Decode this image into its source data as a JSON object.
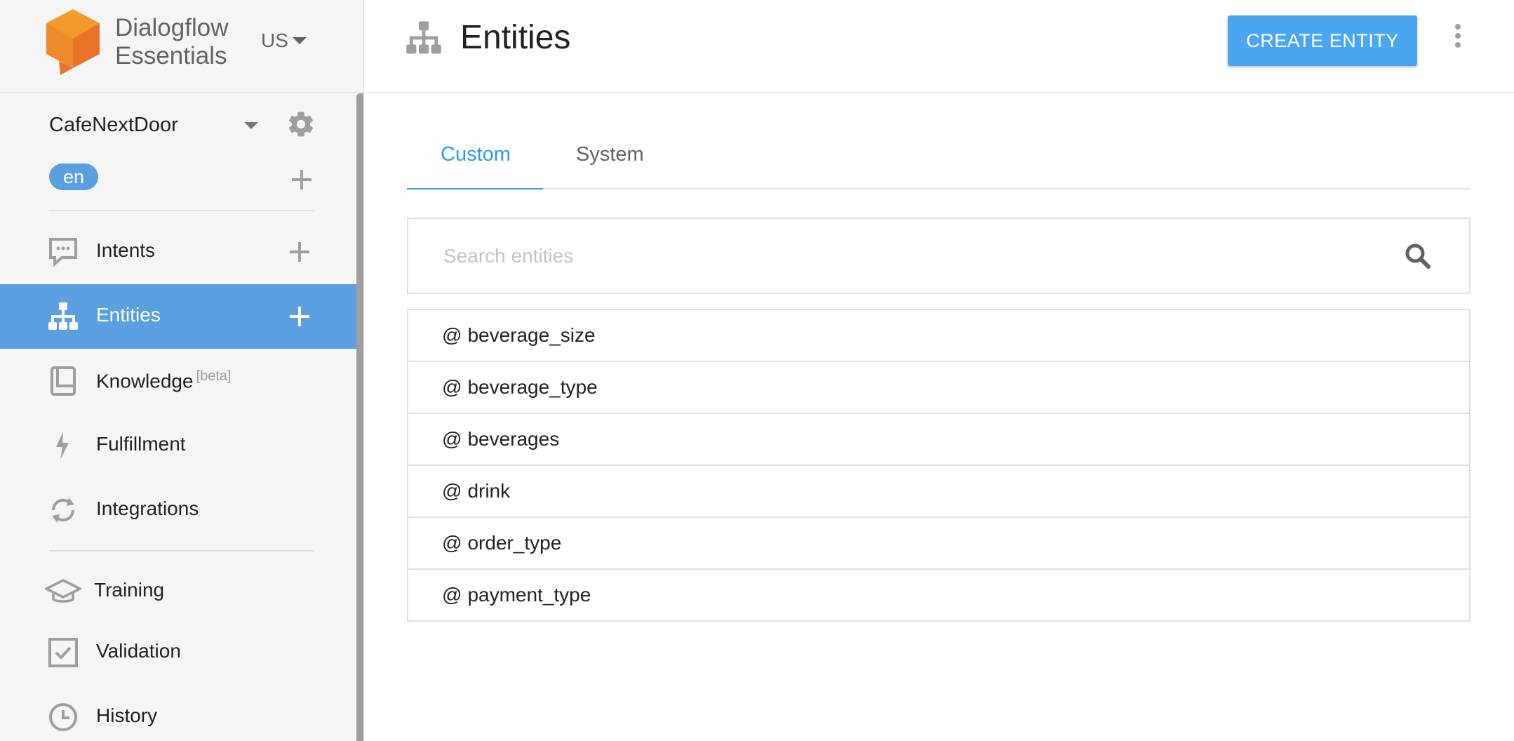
{
  "brand": {
    "line1": "Dialogflow",
    "line2": "Essentials",
    "region": "US"
  },
  "agent": {
    "name": "CafeNextDoor",
    "language": "en"
  },
  "nav": {
    "items": [
      {
        "label": "Intents",
        "icon": "speech-bubble-icon"
      },
      {
        "label": "Entities",
        "icon": "hierarchy-icon",
        "active": true
      },
      {
        "label": "Knowledge",
        "badge": "[beta]",
        "icon": "book-icon"
      },
      {
        "label": "Fulfillment",
        "icon": "lightning-icon"
      },
      {
        "label": "Integrations",
        "icon": "sync-icon"
      },
      {
        "label": "Training",
        "icon": "graduation-cap-icon"
      },
      {
        "label": "Validation",
        "icon": "checkbox-icon"
      },
      {
        "label": "History",
        "icon": "clock-icon"
      }
    ]
  },
  "header": {
    "title": "Entities",
    "create_label": "CREATE ENTITY"
  },
  "tabs": {
    "custom": "Custom",
    "system": "System"
  },
  "search": {
    "placeholder": "Search entities",
    "value": ""
  },
  "entities": {
    "prefix": "@",
    "items": [
      "beverage_size",
      "beverage_type",
      "beverages",
      "drink",
      "order_type",
      "payment_type"
    ]
  },
  "colors": {
    "accent": "#5a9fdf",
    "button": "#4aa6ef",
    "tab_active": "#2f9be6",
    "logo_orange": "#f29a2e"
  }
}
